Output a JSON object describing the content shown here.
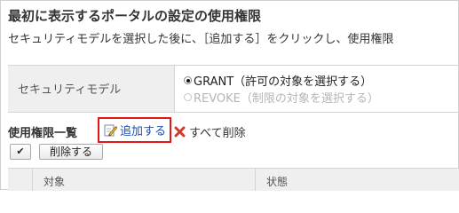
{
  "page": {
    "title": "最初に表示するポータルの設定の使用権限",
    "description": "セキュリティモデルを選択した後に、［追加する］をクリックし、使用権限"
  },
  "security_model": {
    "label": "セキュリティモデル",
    "options": [
      {
        "label": "GRANT（許可の対象を選択する）",
        "selected": true,
        "enabled": true
      },
      {
        "label": "REVOKE（制限の対象を選択する）",
        "selected": false,
        "enabled": false
      }
    ]
  },
  "permission_list": {
    "heading": "使用権限一覧",
    "add_label": "追加する",
    "delete_all_label": "すべて削除",
    "check_all_label": "✔",
    "delete_label": "削除する",
    "columns": [
      "対象",
      "状態"
    ]
  },
  "colors": {
    "highlight_border": "#e01818",
    "link": "#1a4fb5",
    "header_bg": "#efefef"
  },
  "icons": {
    "add": "edit-pencil-icon",
    "delete_all": "red-x-icon"
  }
}
